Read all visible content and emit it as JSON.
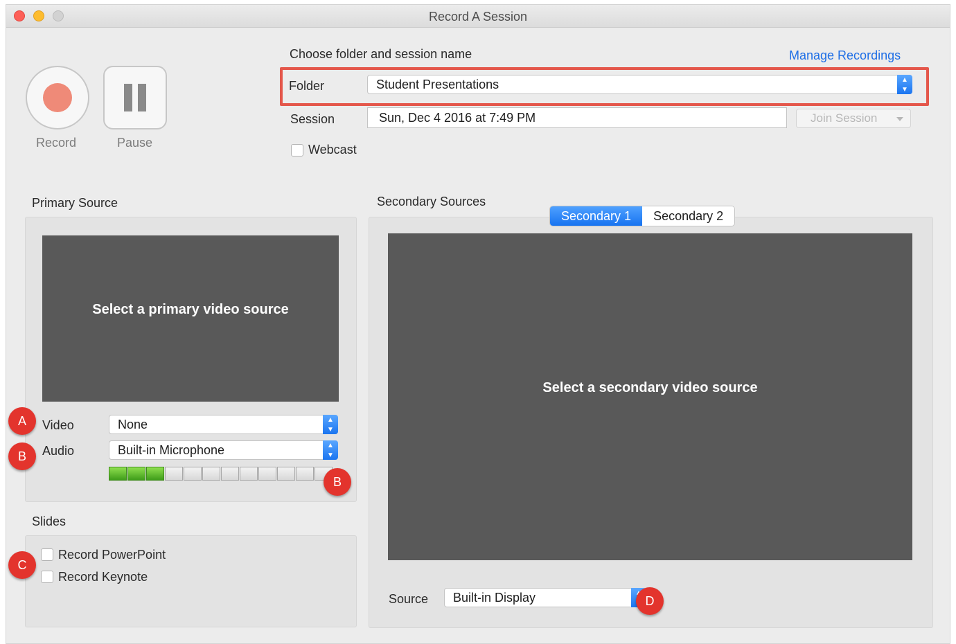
{
  "window": {
    "title": "Record A Session"
  },
  "controls": {
    "record_label": "Record",
    "pause_label": "Pause"
  },
  "session": {
    "heading": "Choose folder and session name",
    "manage_link": "Manage Recordings",
    "folder_label": "Folder",
    "folder_value": "Student Presentations",
    "session_label": "Session",
    "session_value": "Sun, Dec 4 2016 at 7:49 PM",
    "join_button": "Join Session",
    "webcast_label": "Webcast"
  },
  "primary": {
    "heading": "Primary Source",
    "preview_text": "Select a primary video source",
    "video_label": "Video",
    "video_value": "None",
    "audio_label": "Audio",
    "audio_value": "Built-in Microphone",
    "audio_level_segments_on": 3,
    "audio_level_segments_total": 12
  },
  "slides": {
    "heading": "Slides",
    "record_powerpoint": "Record PowerPoint",
    "record_keynote": "Record Keynote"
  },
  "secondary": {
    "heading": "Secondary Sources",
    "tabs": [
      {
        "label": "Secondary 1",
        "active": true
      },
      {
        "label": "Secondary 2",
        "active": false
      }
    ],
    "preview_text": "Select a secondary video source",
    "source_label": "Source",
    "source_value": "Built-in Display"
  },
  "markers": {
    "a": "A",
    "b": "B",
    "c": "C",
    "d": "D"
  },
  "colors": {
    "accent": "#1b75f0",
    "marker": "#e3342d",
    "highlight_box": "#e4574b",
    "meter_on": "#5cbd2c"
  }
}
